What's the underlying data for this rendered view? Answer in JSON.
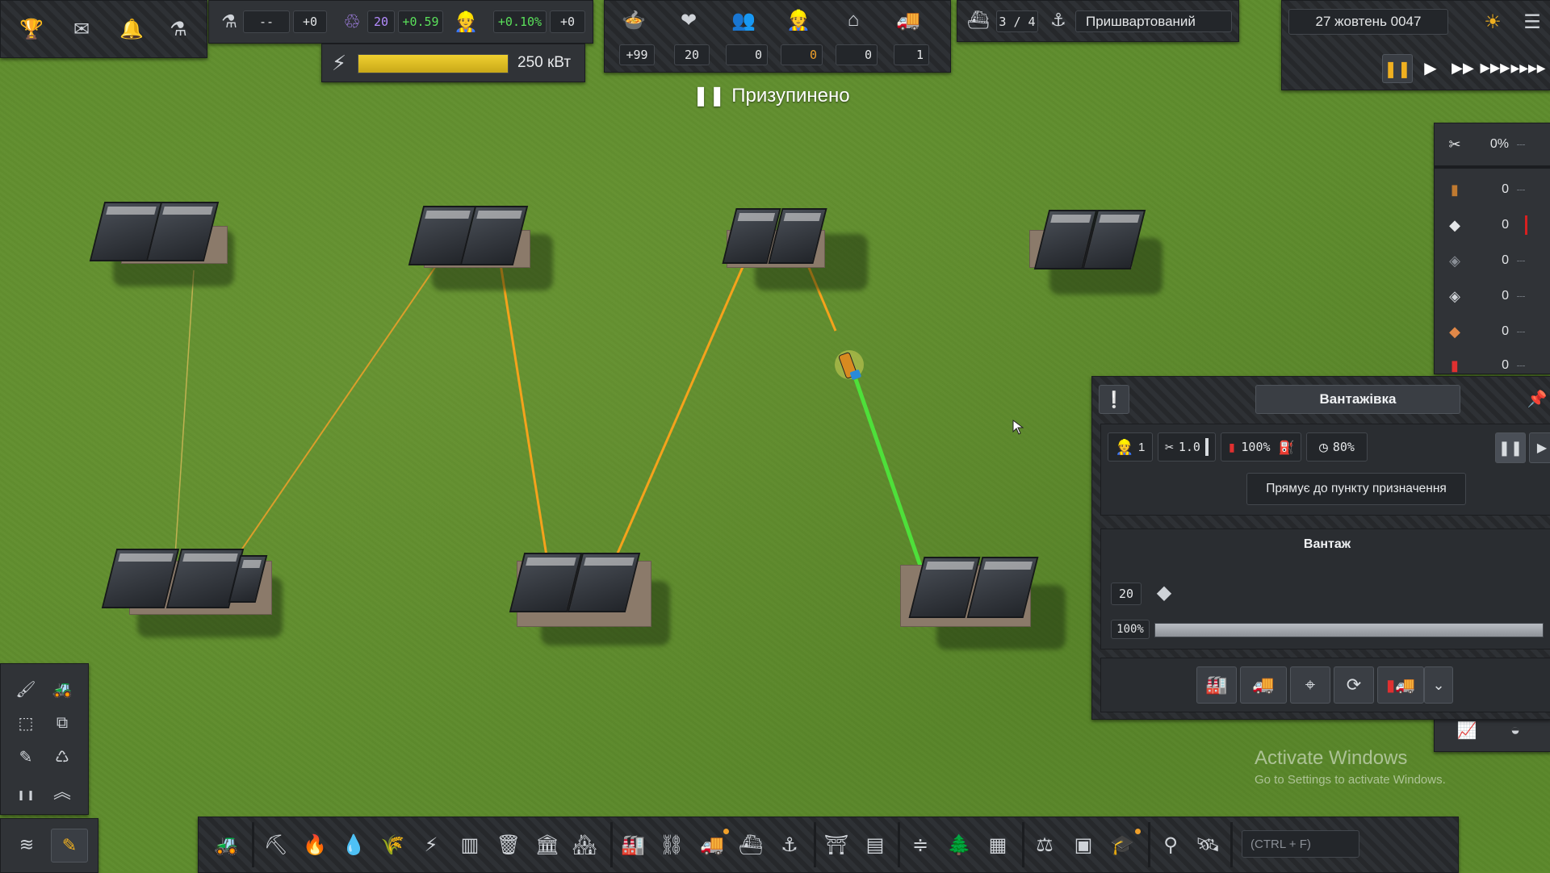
{
  "top_left": {
    "icons": [
      "trophy-icon",
      "mail-icon",
      "bell-icon",
      "flask-icon"
    ]
  },
  "research": {
    "value": "--",
    "delta": "+0"
  },
  "unity": {
    "value": "20",
    "rate": "+0.59",
    "pop_rate": "+0.10%",
    "pop_delta": "+0"
  },
  "power": {
    "value": "250 кВт",
    "fill": 1.0
  },
  "stats": {
    "food": "+99",
    "health": "20",
    "people": "0",
    "workers": "0",
    "housing": "0",
    "vehicles": "1"
  },
  "ship": {
    "count": "3 / 4",
    "status": "Пришвартований"
  },
  "date": "27 жовтень 0047",
  "paused_label": "Призупинено",
  "resources": {
    "maintenance": "0%",
    "items": [
      "0",
      "0",
      "0",
      "0",
      "0",
      "0"
    ]
  },
  "vehicle_panel": {
    "title": "Вантажівка",
    "workers": "1",
    "maintenance": "1.0",
    "fuel": "100%",
    "efficiency": "80%",
    "tooltip": "Прямує до пункту призначення",
    "cargo_title": "Вантаж",
    "cargo_qty": "20",
    "cargo_fill_pct": "100%",
    "cargo_fill": 1.0
  },
  "watermark": {
    "title": "Activate Windows",
    "subtitle": "Go to Settings to activate Windows."
  },
  "search": {
    "placeholder": "(CTRL + F)"
  },
  "colors": {
    "accent": "#f0a02a",
    "route_active": "#4ee03a",
    "power_bar": "#e0c020",
    "unity": "#b48cff",
    "positive": "#5ae05a"
  }
}
